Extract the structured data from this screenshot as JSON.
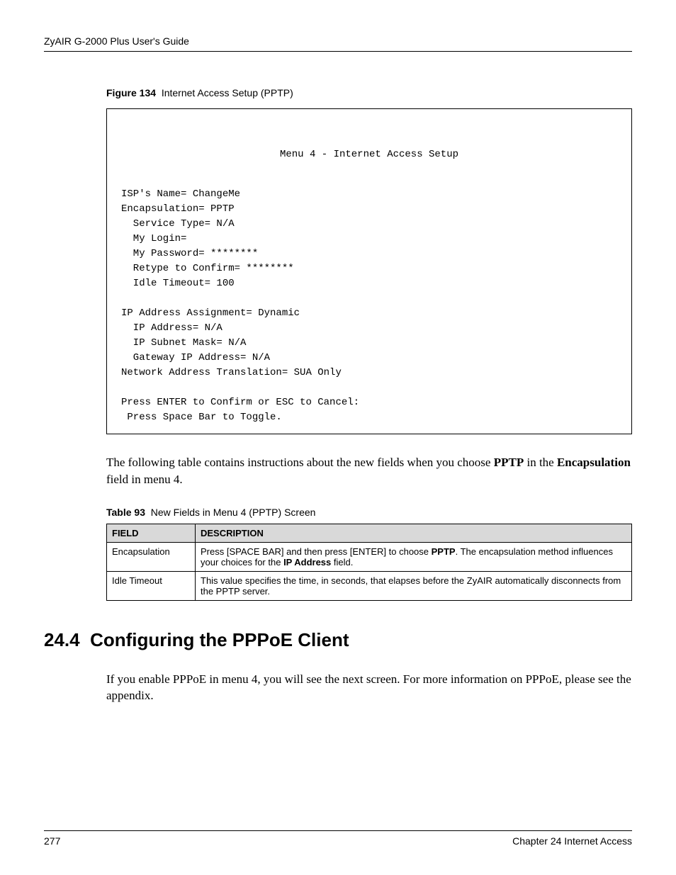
{
  "header": {
    "running_title": "ZyAIR G-2000 Plus User's Guide"
  },
  "figure": {
    "label": "Figure 134",
    "title": "Internet Access Setup (PPTP)",
    "menu_title": "Menu 4 - Internet Access Setup",
    "lines": {
      "l1": "ISP's Name= ChangeMe",
      "l2": "Encapsulation= PPTP",
      "l3": "  Service Type= N/A",
      "l4": "  My Login=",
      "l5": "  My Password= ********",
      "l6": "  Retype to Confirm= ********",
      "l7": "  Idle Timeout= 100",
      "l8": "IP Address Assignment= Dynamic",
      "l9": "  IP Address= N/A",
      "l10": "  IP Subnet Mask= N/A",
      "l11": "  Gateway IP Address= N/A",
      "l12": "Network Address Translation= SUA Only",
      "l13": "Press ENTER to Confirm or ESC to Cancel:",
      "l14": " Press Space Bar to Toggle."
    }
  },
  "intro_para": {
    "t1": "The following table contains instructions about the new fields when you choose ",
    "bold1": "PPTP",
    "t2": " in the ",
    "bold2": "Encapsulation",
    "t3": " field in menu 4."
  },
  "table": {
    "label": "Table 93",
    "title": "New Fields in Menu 4 (PPTP) Screen",
    "headers": {
      "c1": "FIELD",
      "c2": "DESCRIPTION"
    },
    "rows": [
      {
        "field": "Encapsulation",
        "desc_pre": "Press [SPACE BAR] and then press [ENTER] to choose ",
        "desc_b1": "PPTP",
        "desc_mid": ". The encapsulation method influences your choices for the ",
        "desc_b2": "IP Address",
        "desc_post": " field."
      },
      {
        "field": "Idle Timeout",
        "desc_plain": "This value specifies the time, in seconds, that elapses before the ZyAIR automatically disconnects from the PPTP server."
      }
    ]
  },
  "section": {
    "number": "24.4",
    "title": "Configuring the PPPoE Client",
    "para": "If you enable PPPoE in menu 4, you will see the next screen. For more information on PPPoE, please see the appendix."
  },
  "footer": {
    "page": "277",
    "chapter": "Chapter 24 Internet Access"
  }
}
